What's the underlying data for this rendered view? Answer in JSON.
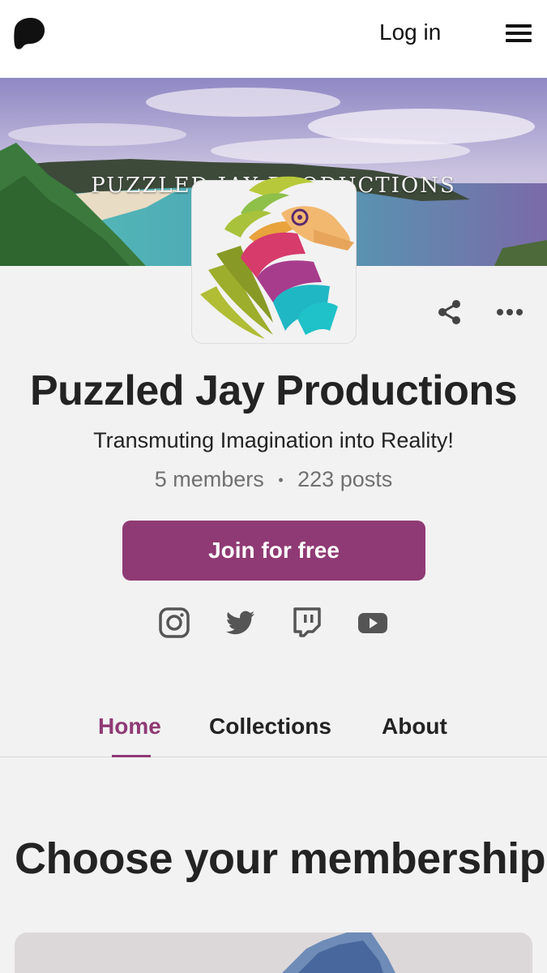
{
  "header": {
    "login_label": "Log in",
    "logo_icon": "patreon-logo-icon",
    "menu_icon": "hamburger-menu-icon"
  },
  "banner": {
    "text": "PUZZLED JAY PRODUCTIONS"
  },
  "creator": {
    "name": "Puzzled Jay Productions",
    "tagline": "Transmuting Imagination into Reality!",
    "members": "5 members",
    "posts": "223 posts",
    "separator": "•"
  },
  "actions": {
    "join_label": "Join for free",
    "share_icon": "share-icon",
    "more_icon": "more-options-icon"
  },
  "social": [
    "instagram-icon",
    "twitter-icon",
    "twitch-icon",
    "youtube-icon"
  ],
  "tabs": [
    {
      "label": "Home",
      "active": true
    },
    {
      "label": "Collections",
      "active": false
    },
    {
      "label": "About",
      "active": false
    }
  ],
  "membership": {
    "title": "Choose your membership"
  },
  "colors": {
    "accent": "#8f3a74",
    "background": "#f2f2f2",
    "text": "#232323",
    "muted": "#707070"
  }
}
